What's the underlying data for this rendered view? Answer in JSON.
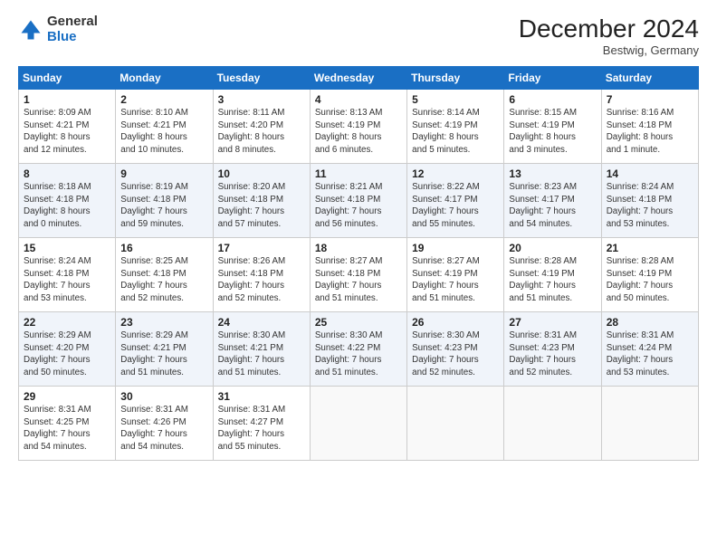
{
  "header": {
    "logo_general": "General",
    "logo_blue": "Blue",
    "month_title": "December 2024",
    "location": "Bestwig, Germany"
  },
  "weekdays": [
    "Sunday",
    "Monday",
    "Tuesday",
    "Wednesday",
    "Thursday",
    "Friday",
    "Saturday"
  ],
  "weeks": [
    [
      {
        "day": "1",
        "info": "Sunrise: 8:09 AM\nSunset: 4:21 PM\nDaylight: 8 hours\nand 12 minutes."
      },
      {
        "day": "2",
        "info": "Sunrise: 8:10 AM\nSunset: 4:21 PM\nDaylight: 8 hours\nand 10 minutes."
      },
      {
        "day": "3",
        "info": "Sunrise: 8:11 AM\nSunset: 4:20 PM\nDaylight: 8 hours\nand 8 minutes."
      },
      {
        "day": "4",
        "info": "Sunrise: 8:13 AM\nSunset: 4:19 PM\nDaylight: 8 hours\nand 6 minutes."
      },
      {
        "day": "5",
        "info": "Sunrise: 8:14 AM\nSunset: 4:19 PM\nDaylight: 8 hours\nand 5 minutes."
      },
      {
        "day": "6",
        "info": "Sunrise: 8:15 AM\nSunset: 4:19 PM\nDaylight: 8 hours\nand 3 minutes."
      },
      {
        "day": "7",
        "info": "Sunrise: 8:16 AM\nSunset: 4:18 PM\nDaylight: 8 hours\nand 1 minute."
      }
    ],
    [
      {
        "day": "8",
        "info": "Sunrise: 8:18 AM\nSunset: 4:18 PM\nDaylight: 8 hours\nand 0 minutes."
      },
      {
        "day": "9",
        "info": "Sunrise: 8:19 AM\nSunset: 4:18 PM\nDaylight: 7 hours\nand 59 minutes."
      },
      {
        "day": "10",
        "info": "Sunrise: 8:20 AM\nSunset: 4:18 PM\nDaylight: 7 hours\nand 57 minutes."
      },
      {
        "day": "11",
        "info": "Sunrise: 8:21 AM\nSunset: 4:18 PM\nDaylight: 7 hours\nand 56 minutes."
      },
      {
        "day": "12",
        "info": "Sunrise: 8:22 AM\nSunset: 4:17 PM\nDaylight: 7 hours\nand 55 minutes."
      },
      {
        "day": "13",
        "info": "Sunrise: 8:23 AM\nSunset: 4:17 PM\nDaylight: 7 hours\nand 54 minutes."
      },
      {
        "day": "14",
        "info": "Sunrise: 8:24 AM\nSunset: 4:18 PM\nDaylight: 7 hours\nand 53 minutes."
      }
    ],
    [
      {
        "day": "15",
        "info": "Sunrise: 8:24 AM\nSunset: 4:18 PM\nDaylight: 7 hours\nand 53 minutes."
      },
      {
        "day": "16",
        "info": "Sunrise: 8:25 AM\nSunset: 4:18 PM\nDaylight: 7 hours\nand 52 minutes."
      },
      {
        "day": "17",
        "info": "Sunrise: 8:26 AM\nSunset: 4:18 PM\nDaylight: 7 hours\nand 52 minutes."
      },
      {
        "day": "18",
        "info": "Sunrise: 8:27 AM\nSunset: 4:18 PM\nDaylight: 7 hours\nand 51 minutes."
      },
      {
        "day": "19",
        "info": "Sunrise: 8:27 AM\nSunset: 4:19 PM\nDaylight: 7 hours\nand 51 minutes."
      },
      {
        "day": "20",
        "info": "Sunrise: 8:28 AM\nSunset: 4:19 PM\nDaylight: 7 hours\nand 51 minutes."
      },
      {
        "day": "21",
        "info": "Sunrise: 8:28 AM\nSunset: 4:19 PM\nDaylight: 7 hours\nand 50 minutes."
      }
    ],
    [
      {
        "day": "22",
        "info": "Sunrise: 8:29 AM\nSunset: 4:20 PM\nDaylight: 7 hours\nand 50 minutes."
      },
      {
        "day": "23",
        "info": "Sunrise: 8:29 AM\nSunset: 4:21 PM\nDaylight: 7 hours\nand 51 minutes."
      },
      {
        "day": "24",
        "info": "Sunrise: 8:30 AM\nSunset: 4:21 PM\nDaylight: 7 hours\nand 51 minutes."
      },
      {
        "day": "25",
        "info": "Sunrise: 8:30 AM\nSunset: 4:22 PM\nDaylight: 7 hours\nand 51 minutes."
      },
      {
        "day": "26",
        "info": "Sunrise: 8:30 AM\nSunset: 4:23 PM\nDaylight: 7 hours\nand 52 minutes."
      },
      {
        "day": "27",
        "info": "Sunrise: 8:31 AM\nSunset: 4:23 PM\nDaylight: 7 hours\nand 52 minutes."
      },
      {
        "day": "28",
        "info": "Sunrise: 8:31 AM\nSunset: 4:24 PM\nDaylight: 7 hours\nand 53 minutes."
      }
    ],
    [
      {
        "day": "29",
        "info": "Sunrise: 8:31 AM\nSunset: 4:25 PM\nDaylight: 7 hours\nand 54 minutes."
      },
      {
        "day": "30",
        "info": "Sunrise: 8:31 AM\nSunset: 4:26 PM\nDaylight: 7 hours\nand 54 minutes."
      },
      {
        "day": "31",
        "info": "Sunrise: 8:31 AM\nSunset: 4:27 PM\nDaylight: 7 hours\nand 55 minutes."
      },
      null,
      null,
      null,
      null
    ]
  ]
}
